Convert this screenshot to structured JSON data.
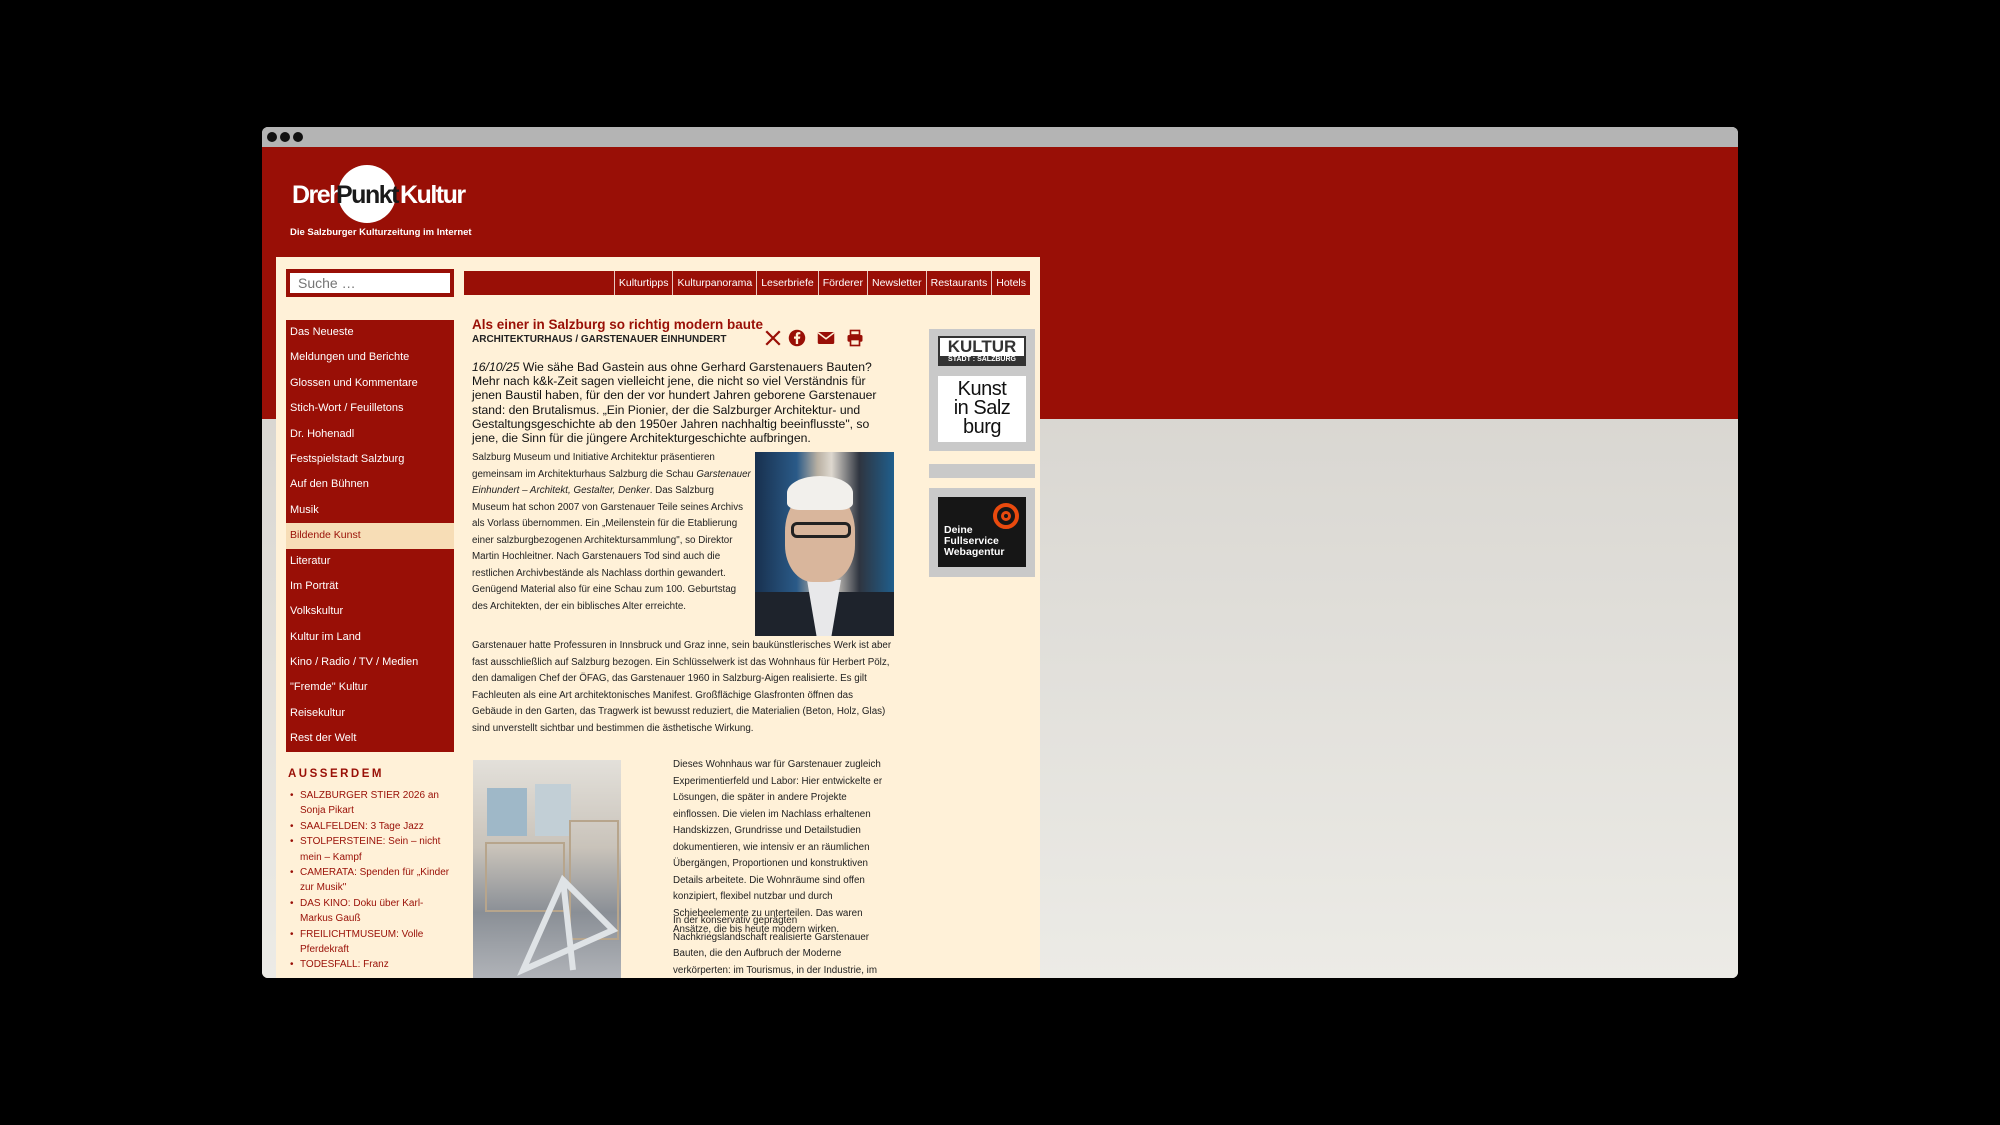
{
  "window": {
    "controls": [
      "close",
      "minimize",
      "maximize"
    ]
  },
  "logo": {
    "part1": "Dreh",
    "part2": "Punkt",
    "part3": "Kultur",
    "tagline": "Die Salzburger Kulturzeitung im Internet"
  },
  "search": {
    "placeholder": "Suche …"
  },
  "topnav": [
    "Kulturtipps",
    "Kulturpanorama",
    "Leserbriefe",
    "Förderer",
    "Newsletter",
    "Restaurants",
    "Hotels"
  ],
  "sidenav": {
    "items": [
      "Das Neueste",
      "Meldungen und Berichte",
      "Glossen und Kommentare",
      "Stich-Wort / Feuilletons",
      "Dr. Hohenadl",
      "Festspielstadt Salzburg",
      "Auf den Bühnen",
      "Musik",
      "Bildende Kunst",
      "Literatur",
      "Im Porträt",
      "Volkskultur",
      "Kultur im Land",
      "Kino / Radio / TV / Medien",
      "\"Fremde\" Kultur",
      "Reisekultur",
      "Rest der Welt"
    ],
    "active": "Bildende Kunst"
  },
  "aside": {
    "title": "AUSSERDEM",
    "items": [
      "SALZBURGER STIER 2026 an Sonja Pikart",
      "SAALFELDEN: 3 Tage Jazz",
      "STOLPERSTEINE: Sein – nicht mein – Kampf",
      "CAMERATA: Spenden für „Kinder zur Musik\"",
      "DAS KINO: Doku über Karl-Markus Gauß",
      "FREILICHTMUSEUM: Volle Pferdekraft",
      "TODESFALL: Franz"
    ]
  },
  "article": {
    "title": "Als einer in Salzburg so richtig modern baute",
    "subtitle": "ARCHITEKTURHAUS / GARSTENAUER EINHUNDERT",
    "date": "16/10/25",
    "lead": " Wie sähe Bad Gastein aus ohne Gerhard Garstenauers Bauten? Mehr nach k&k-Zeit sagen vielleicht jene, die nicht so viel Verständnis für jenen Baustil haben, für den der vor hundert Jahren geborene Garstenauer stand: den Brutalismus. „Ein Pionier, der die Salzburger Architektur- und Gestaltungsgeschichte ab den 1950er Jahren nachhaltig beeinflusste\", so jene, die Sinn für die jüngere Architekturgeschichte aufbringen.",
    "p1_a": "Salzburg Museum und Initiative Architektur präsentieren gemeinsam im Architekturhaus Salzburg die Schau ",
    "p1_em": "Garstenauer Einhundert – Architekt, Gestalter, Denker",
    "p1_b": ". Das Salzburg Museum hat schon 2007 von Garstenauer Teile seines Archivs als Vorlass übernommen. Ein „Meilenstein für die Etablierung einer salzburgbezogenen Architektursammlung\", so Direktor Martin Hochleitner. Nach Garstenauers Tod sind auch die restlichen Archivbestände als Nachlass dorthin gewandert. Genügend Material also für eine Schau zum 100. Geburtstag des Architekten, der ein biblisches Alter erreichte.",
    "p2": "Garstenauer hatte Professuren in Innsbruck und Graz inne, sein baukünstlerisches Werk ist aber fast ausschließlich auf Salzburg bezogen. Ein Schlüsselwerk ist das Wohnhaus für Herbert Pölz, den damaligen Chef der ÖFAG, das Garstenauer 1960 in Salzburg-Aigen realisierte. Es gilt Fachleuten als eine Art architektonisches Manifest. Großflächige Glasfronten öffnen das Gebäude in den Garten, das Tragwerk ist bewusst reduziert, die Materialien (Beton, Holz, Glas) sind unverstellt sichtbar und bestimmen die ästhetische Wirkung.",
    "p3": "Dieses Wohnhaus war für Garstenauer zugleich Experimentierfeld und Labor: Hier entwickelte er Lösungen, die später in andere Projekte einflossen. Die vielen im Nachlass erhaltenen Handskizzen, Grundrisse und Detailstudien dokumentieren, wie intensiv er an räumlichen Übergängen, Proportionen und konstruktiven Details arbeitete. Die Wohnräume sind offen konzipiert, flexibel nutzbar und durch Schiebeelemente zu unterteilen. Das waren Ansätze, die bis heute modern wirken.",
    "p4": "In der konservativ geprägten Nachkriegslandschaft realisierte Garstenauer Bauten, die den Aufbruch der Moderne verkörperten: im Tourismus, in der Industrie, im Wohnbau. Werke wie die Felsentherme in Bad Gastein"
  },
  "share_icons": [
    "x-icon",
    "facebook-icon",
    "email-icon",
    "print-icon"
  ],
  "ads": {
    "kultur": "KULTUR",
    "kultur_sub": "STADT : SALZBURG",
    "kunst": [
      "Kunst",
      "in Salz",
      "burg"
    ],
    "agency": [
      "Deine",
      "Fullservice",
      "Webagentur"
    ]
  },
  "colors": {
    "brand_red": "#990f06",
    "content_bg": "#fff1d8",
    "active_nav_bg": "#f7ddb6",
    "agency_orange": "#e94a0e"
  }
}
